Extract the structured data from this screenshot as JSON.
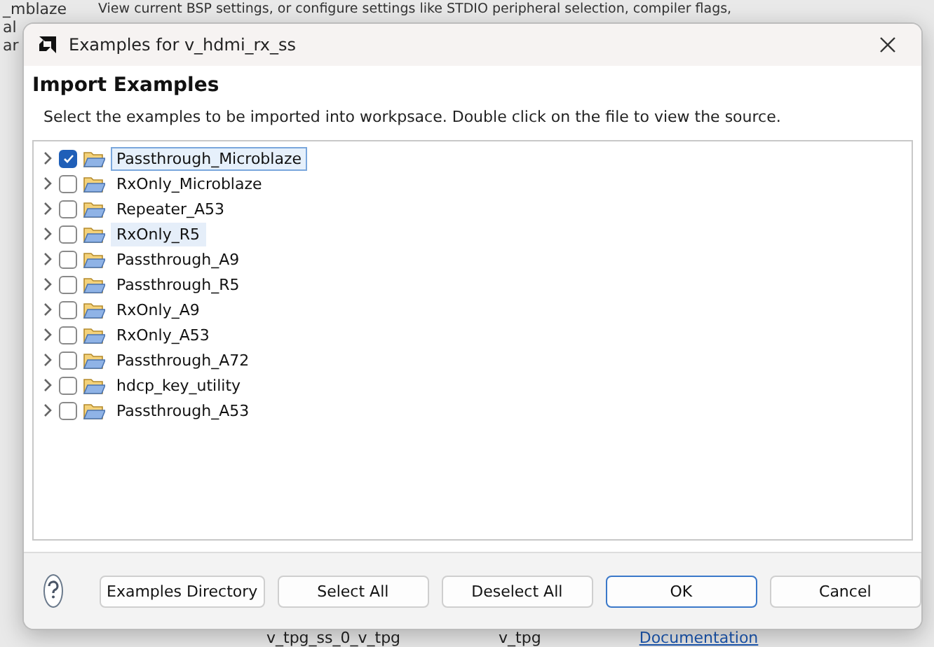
{
  "background": {
    "top_text": "View current BSP settings, or configure settings like STDIO peripheral selection, compiler flags,",
    "left_fragments": [
      "_mblaze",
      "al",
      "ar"
    ],
    "bottom_row": [
      "v_tpg_ss_0_v_tpg",
      "v_tpg",
      "Documentation"
    ]
  },
  "dialog": {
    "title": "Examples for v_hdmi_rx_ss",
    "heading": "Import Examples",
    "description": "Select the examples to be imported into workpsace. Double click on the file to view the source.",
    "examples": [
      {
        "label": "Passthrough_Microblaze",
        "checked": true,
        "selected": true,
        "highlighted": false
      },
      {
        "label": "RxOnly_Microblaze",
        "checked": false,
        "selected": false,
        "highlighted": false
      },
      {
        "label": "Repeater_A53",
        "checked": false,
        "selected": false,
        "highlighted": false
      },
      {
        "label": "RxOnly_R5",
        "checked": false,
        "selected": false,
        "highlighted": true
      },
      {
        "label": "Passthrough_A9",
        "checked": false,
        "selected": false,
        "highlighted": false
      },
      {
        "label": "Passthrough_R5",
        "checked": false,
        "selected": false,
        "highlighted": false
      },
      {
        "label": "RxOnly_A9",
        "checked": false,
        "selected": false,
        "highlighted": false
      },
      {
        "label": "RxOnly_A53",
        "checked": false,
        "selected": false,
        "highlighted": false
      },
      {
        "label": "Passthrough_A72",
        "checked": false,
        "selected": false,
        "highlighted": false
      },
      {
        "label": "hdcp_key_utility",
        "checked": false,
        "selected": false,
        "highlighted": false
      },
      {
        "label": "Passthrough_A53",
        "checked": false,
        "selected": false,
        "highlighted": false
      }
    ],
    "buttons": [
      {
        "label": "Examples Directory",
        "default": false
      },
      {
        "label": "Select All",
        "default": false
      },
      {
        "label": "Deselect All",
        "default": false
      },
      {
        "label": "OK",
        "default": true
      },
      {
        "label": "Cancel",
        "default": false
      }
    ]
  }
}
